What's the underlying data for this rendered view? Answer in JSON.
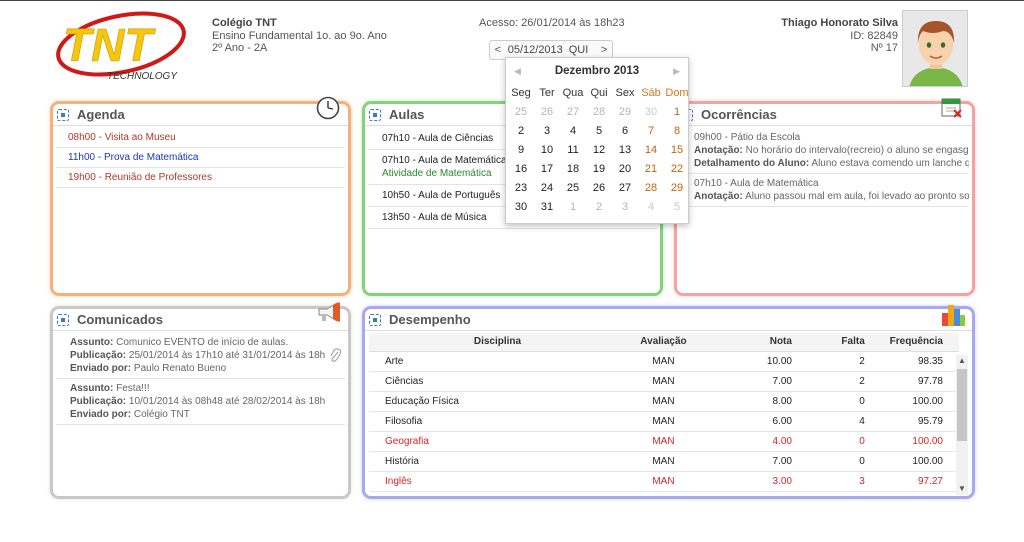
{
  "header": {
    "school_name": "Colégio TNT",
    "school_level": "Ensino Fundamental 1o. ao 9o. Ano",
    "school_class": "2º Ano - 2A",
    "access": "Acesso: 26/01/2014 às 18h23",
    "date_value": "05/12/2013",
    "date_dow": "QUI",
    "date_prev": "<",
    "date_next": ">",
    "logo_text": "TNT",
    "logo_sub": "TECHNOLOGY",
    "user_name": "Thiago Honorato Silva",
    "user_id": "ID: 82849",
    "user_number": "Nº 17"
  },
  "calendar": {
    "month_title": "Dezembro 2013",
    "weekdays": [
      "Seg",
      "Ter",
      "Qua",
      "Qui",
      "Sex",
      "Sáb",
      "Dom"
    ],
    "weeks": [
      [
        "25",
        "26",
        "27",
        "28",
        "29",
        "30",
        "1"
      ],
      [
        "2",
        "3",
        "4",
        "5",
        "6",
        "7",
        "8"
      ],
      [
        "9",
        "10",
        "11",
        "12",
        "13",
        "14",
        "15"
      ],
      [
        "16",
        "17",
        "18",
        "19",
        "20",
        "21",
        "22"
      ],
      [
        "23",
        "24",
        "25",
        "26",
        "27",
        "28",
        "29"
      ],
      [
        "30",
        "31",
        "1",
        "2",
        "3",
        "4",
        "5"
      ]
    ]
  },
  "agenda": {
    "title": "Agenda",
    "items": [
      {
        "text": "08h00 - Visita ao Museu",
        "color": "#b0382a"
      },
      {
        "text": "11h00 - Prova de Matemática",
        "color": "#1a35c4"
      },
      {
        "text": "19h00 - Reunião de Professores",
        "color": "#b0382a"
      }
    ]
  },
  "aulas": {
    "title": "Aulas",
    "items": [
      {
        "text": "07h10 - Aula de Ciências",
        "sub": ""
      },
      {
        "text": "07h10 - Aula de Matemática",
        "sub": "Atividade de Matemática"
      },
      {
        "text": "10h50 - Aula de Português",
        "sub": ""
      },
      {
        "text": "13h50 - Aula de Música",
        "sub": ""
      }
    ]
  },
  "ocorrencias": {
    "title": "Ocorrências",
    "items": [
      {
        "head": "09h00 - Pátio da Escola",
        "l1_label": "Anotação:",
        "l1_text": " No horário do intervalo(recreio) o aluno se engasgou c",
        "l2_label": "Detalhamento do Aluno:",
        "l2_text": " Aluno estava comendo um lanche que t"
      },
      {
        "head": "07h10 - Aula de Matemática",
        "l1_label": "Anotação:",
        "l1_text": " Aluno passou mal em aula, foi levado ao pronto socor",
        "l2_label": "",
        "l2_text": ""
      }
    ]
  },
  "comunicados": {
    "title": "Comunicados",
    "items": [
      {
        "assunto_label": "Assunto:",
        "assunto": " Comunico EVENTO de início de aulas.",
        "pub_label": "Publicação:",
        "pub": " 25/01/2014 às 17h10 até 31/01/2014 às 18h",
        "env_label": "Enviado por:",
        "env": " Paulo Renato Bueno"
      },
      {
        "assunto_label": "Assunto:",
        "assunto": " Festa!!!",
        "pub_label": "Publicação:",
        "pub": " 10/01/2014 às 08h48 até 28/02/2014 às 18h",
        "env_label": "Enviado por:",
        "env": " Colégio TNT"
      }
    ]
  },
  "desempenho": {
    "title": "Desempenho",
    "columns": [
      "Disciplina",
      "Avaliação",
      "Nota",
      "Falta",
      "Frequência"
    ],
    "rows": [
      {
        "disc": "Arte",
        "av": "MAN",
        "nota": "10.00",
        "falta": "2",
        "freq": "98.35",
        "red": false
      },
      {
        "disc": "Ciências",
        "av": "MAN",
        "nota": "7.00",
        "falta": "2",
        "freq": "97.78",
        "red": false
      },
      {
        "disc": "Educação Física",
        "av": "MAN",
        "nota": "8.00",
        "falta": "0",
        "freq": "100.00",
        "red": false
      },
      {
        "disc": "Filosofia",
        "av": "MAN",
        "nota": "6.00",
        "falta": "4",
        "freq": "95.79",
        "red": false
      },
      {
        "disc": "Geografia",
        "av": "MAN",
        "nota": "4.00",
        "falta": "0",
        "freq": "100.00",
        "red": true
      },
      {
        "disc": "História",
        "av": "MAN",
        "nota": "7.00",
        "falta": "0",
        "freq": "100.00",
        "red": false
      },
      {
        "disc": "Inglês",
        "av": "MAN",
        "nota": "3.00",
        "falta": "3",
        "freq": "97.27",
        "red": true
      }
    ]
  },
  "colors": {
    "agenda_border": "#f6b07a",
    "aulas_border": "#86d07f",
    "ocorr_border": "#f4a3a3",
    "comun_border": "#c8c8c8",
    "desemp_border": "#a8a8f0",
    "weekend": "#c8610a",
    "fail_red": "#d22222",
    "logo_yellow": "#f5c60d",
    "logo_red": "#d01818"
  }
}
